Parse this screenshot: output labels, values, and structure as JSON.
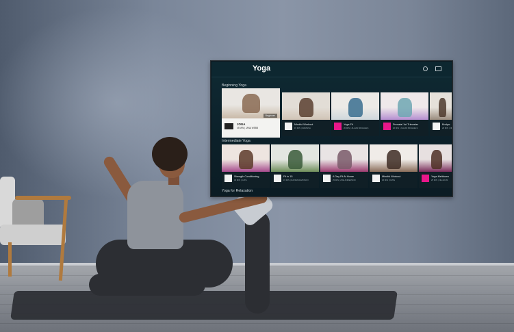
{
  "tv_app": {
    "title": "Yoga",
    "icons": [
      "user-icon",
      "cast-icon"
    ],
    "sections": [
      {
        "label": "Beginning Yoga",
        "cards": [
          {
            "title": "JOGA",
            "meta": "45 MIN | JANA WEBB",
            "badge": "Beginner",
            "logo": "fitfuture",
            "featured": true
          },
          {
            "title": "Mindful Workout",
            "meta": "15 MIN | MARISSA",
            "badge": "",
            "logo": "fitfuture"
          },
          {
            "title": "Yoga Fit",
            "meta": "20 MIN | JILLIAN MICHAELS",
            "badge": "",
            "logo": "jillian"
          },
          {
            "title": "Prenatal 1st Trimester",
            "meta": "20 MIN | JILLIAN MICHAELS",
            "badge": "",
            "logo": "jillian"
          },
          {
            "title": "Bodyw",
            "meta": "20 MIN | JILLIAN M",
            "badge": "",
            "logo": "fitfuture"
          }
        ]
      },
      {
        "label": "Intermediate Yoga",
        "cards": [
          {
            "title": "Strength Conditioning",
            "meta": "30 MIN | CATE",
            "logo": "fitfuture"
          },
          {
            "title": "Fit in 15",
            "meta": "15 MIN | DAVIDA DAVIDSON",
            "logo": "fitfuture"
          },
          {
            "title": "A Day Fit At Home",
            "meta": "25 MIN | ZOE ANDERSON",
            "logo": "fitfuture"
          },
          {
            "title": "Mindful Workout",
            "meta": "25 MIN | KATIE",
            "logo": "fitfuture"
          },
          {
            "title": "Yoga Meltdown",
            "meta": "25 MIN | JILLIAN M",
            "logo": "jillian"
          }
        ]
      },
      {
        "label": "Yoga for Relaxation",
        "cards": []
      }
    ]
  },
  "colors": {
    "accent_pink": "#e8178a",
    "tv_bg": "#0d2730",
    "card_bg": "#101f26"
  }
}
